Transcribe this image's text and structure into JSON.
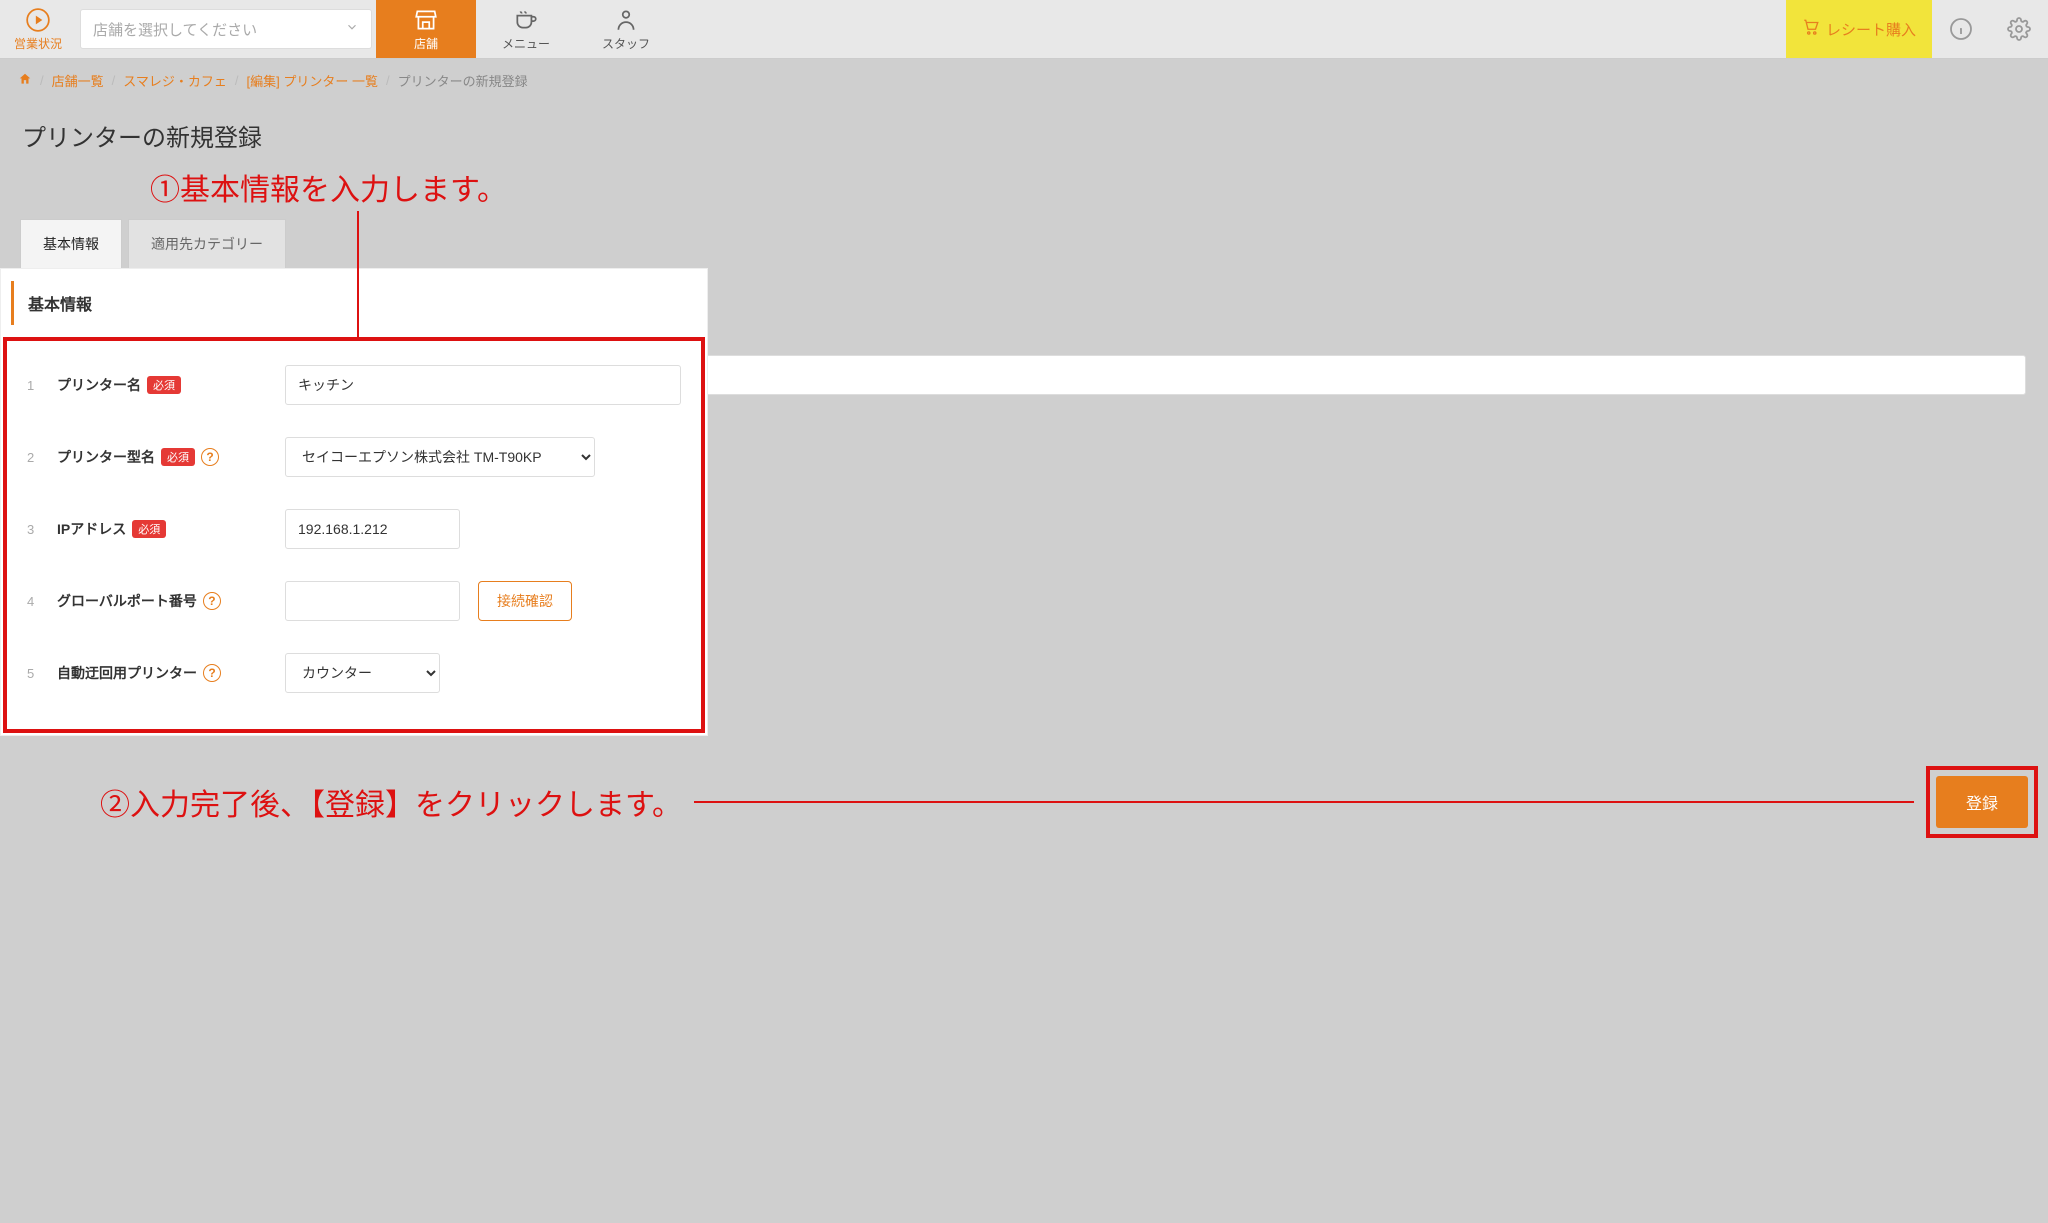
{
  "header": {
    "status_label": "営業状況",
    "store_select_placeholder": "店舗を選択してください",
    "nav": {
      "store": "店舗",
      "menu": "メニュー",
      "staff": "スタッフ"
    },
    "receipt_button": "レシート購入"
  },
  "breadcrumb": {
    "items": [
      "店舗一覧",
      "スマレジ・カフェ",
      "[編集] プリンター 一覧"
    ],
    "current": "プリンターの新規登録"
  },
  "page_title": "プリンターの新規登録",
  "annot": {
    "one": "①基本情報を入力します。",
    "two": "②入力完了後、【登録】をクリックします。"
  },
  "tabs": {
    "basic": "基本情報",
    "category": "適用先カテゴリー"
  },
  "section": {
    "basic_info": "基本情報"
  },
  "labels": {
    "required": "必須",
    "printer_name": "プリンター名",
    "printer_model": "プリンター型名",
    "ip_address": "IPアドレス",
    "global_port": "グローバルポート番号",
    "auto_reroute": "自動迂回用プリンター"
  },
  "form": {
    "printer_name_value": "キッチン",
    "printer_model_value": "セイコーエプソン株式会社 TM-T90KP",
    "ip_value": "192.168.1.212",
    "port_value": "",
    "reroute_value": "カウンター"
  },
  "buttons": {
    "check_connection": "接続確認",
    "register": "登録"
  }
}
